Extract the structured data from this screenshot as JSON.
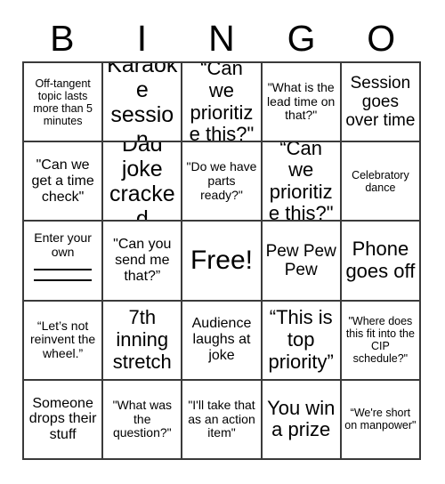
{
  "card": {
    "title_letters": [
      "B",
      "I",
      "N",
      "G",
      "O"
    ],
    "rows": [
      [
        {
          "text": "Off-tangent topic lasts more than 5 minutes",
          "size": "xs"
        },
        {
          "text": "Karaoke session",
          "size": "xxl"
        },
        {
          "text": "“Can we prioritize this?\"",
          "size": "xl"
        },
        {
          "text": "\"What is the lead time on that?\"",
          "size": "sm"
        },
        {
          "text": "Session goes over time",
          "size": "lg"
        }
      ],
      [
        {
          "text": "\"Can we get a time check\"",
          "size": "md"
        },
        {
          "text": "Dad joke cracked",
          "size": "xxl"
        },
        {
          "text": "\"Do we have parts ready?\"",
          "size": "sm"
        },
        {
          "text": "“Can we prioritize this?\"",
          "size": "xl"
        },
        {
          "text": "Celebratory dance",
          "size": "xs"
        }
      ],
      [
        {
          "text": "Enter your own",
          "size": "sm",
          "kind": "write-in",
          "blank_lines": 2
        },
        {
          "text": "\"Can you send me that?”",
          "size": "md"
        },
        {
          "text": "Free!",
          "size": "free"
        },
        {
          "text": "Pew Pew Pew",
          "size": "lg"
        },
        {
          "text": "Phone goes off",
          "size": "xl"
        }
      ],
      [
        {
          "text": "“Let’s not reinvent the wheel.”",
          "size": "sm"
        },
        {
          "text": "7th inning stretch",
          "size": "xl"
        },
        {
          "text": "Audience laughs at joke",
          "size": "md"
        },
        {
          "text": "“This is top priority”",
          "size": "xl"
        },
        {
          "text": "\"Where does this fit into the CIP schedule?\"",
          "size": "xs"
        }
      ],
      [
        {
          "text": "Someone drops their stuff",
          "size": "md"
        },
        {
          "text": "\"What was the question?\"",
          "size": "sm"
        },
        {
          "text": "\"I'll take that as an action item\"",
          "size": "sm"
        },
        {
          "text": "You win a prize",
          "size": "xl"
        },
        {
          "text": "“We're short on manpower\"",
          "size": "xs"
        }
      ]
    ],
    "colors": {
      "grid_line": "#3a3a3a",
      "text": "#000000",
      "background": "#ffffff"
    }
  }
}
